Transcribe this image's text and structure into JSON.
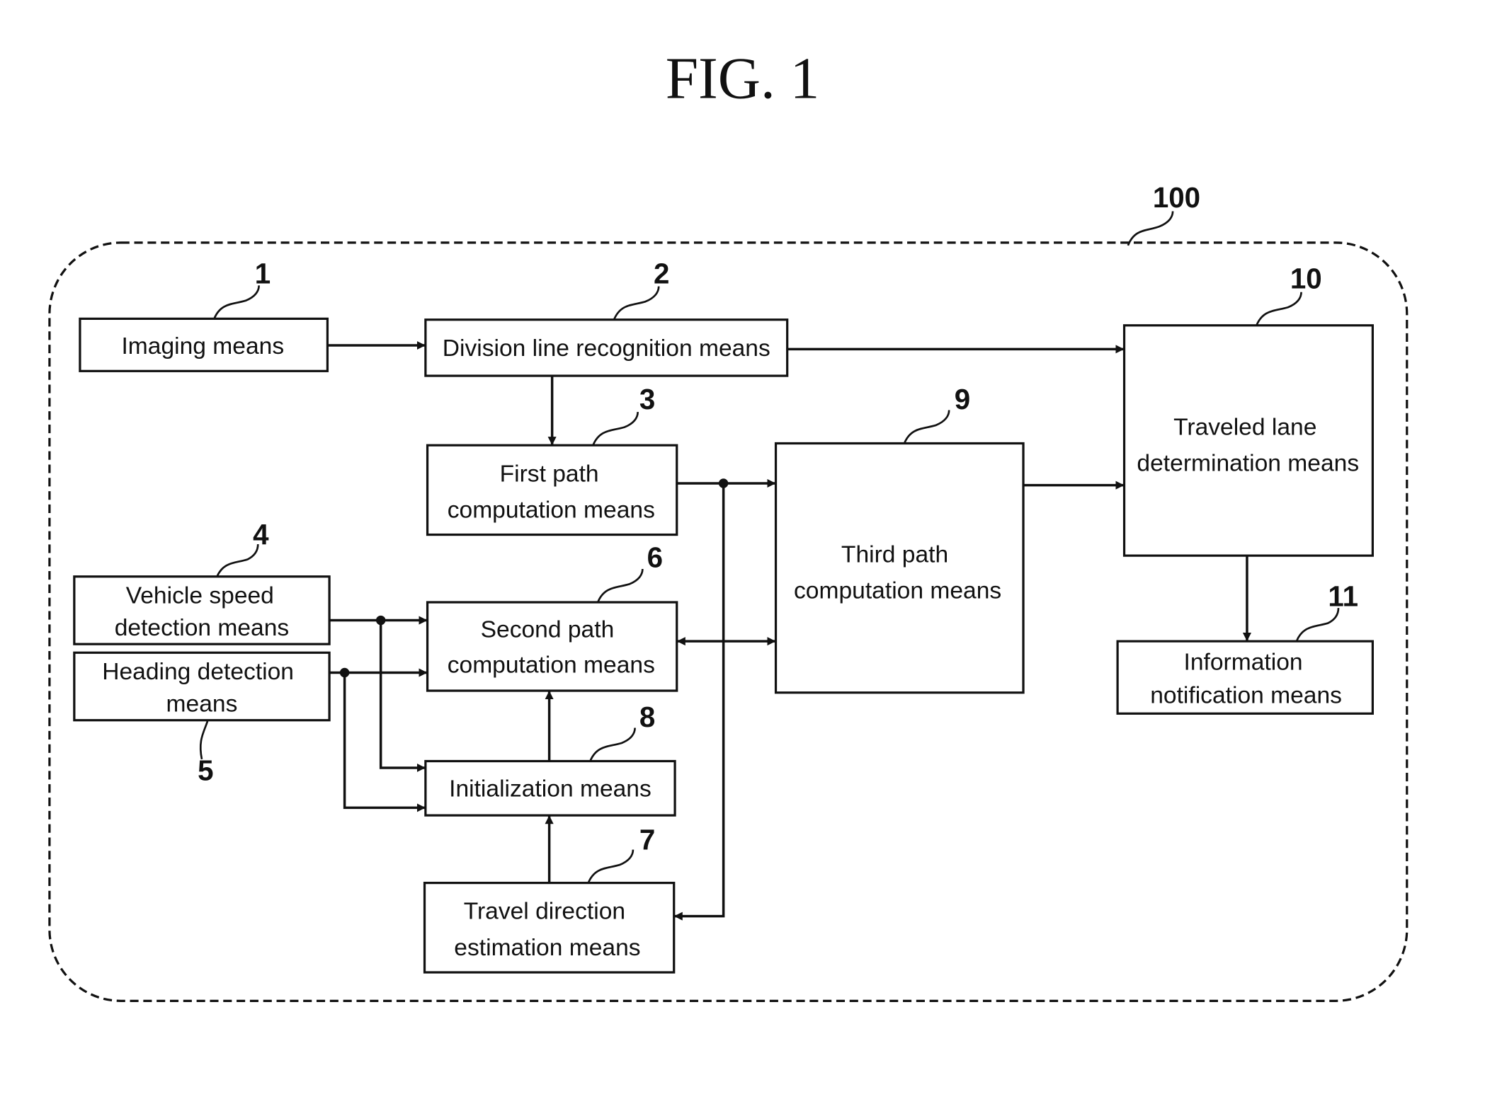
{
  "figure": {
    "title": "FIG. 1",
    "system_ref": "100"
  },
  "blocks": [
    {
      "id": "imaging",
      "ref": "1",
      "lines": [
        "Imaging means"
      ]
    },
    {
      "id": "division",
      "ref": "2",
      "lines": [
        "Division line recognition means"
      ]
    },
    {
      "id": "first_path",
      "ref": "3",
      "lines": [
        "First path",
        "computation means"
      ]
    },
    {
      "id": "vehicle_speed",
      "ref": "4",
      "lines": [
        "Vehicle speed",
        "detection means"
      ]
    },
    {
      "id": "heading",
      "ref": "5",
      "lines": [
        "Heading detection",
        "means"
      ]
    },
    {
      "id": "second_path",
      "ref": "6",
      "lines": [
        "Second path",
        "computation means"
      ]
    },
    {
      "id": "travel_dir",
      "ref": "7",
      "lines": [
        "Travel direction",
        "estimation means"
      ]
    },
    {
      "id": "init",
      "ref": "8",
      "lines": [
        "Initialization means"
      ]
    },
    {
      "id": "third_path",
      "ref": "9",
      "lines": [
        "Third path",
        "computation means"
      ]
    },
    {
      "id": "traveled_lane",
      "ref": "10",
      "lines": [
        "Traveled lane",
        "determination means"
      ]
    },
    {
      "id": "info_notify",
      "ref": "11",
      "lines": [
        "Information",
        "notification means"
      ]
    }
  ],
  "connections": [
    {
      "from": "imaging",
      "to": "division"
    },
    {
      "from": "division",
      "to": "traveled_lane"
    },
    {
      "from": "division",
      "to": "first_path"
    },
    {
      "from": "first_path",
      "to": "third_path"
    },
    {
      "from": "first_path",
      "to": "travel_dir"
    },
    {
      "from": "third_path",
      "to": "traveled_lane"
    },
    {
      "from": "traveled_lane",
      "to": "info_notify"
    },
    {
      "from": "vehicle_speed",
      "to": "second_path"
    },
    {
      "from": "vehicle_speed",
      "to": "init"
    },
    {
      "from": "heading",
      "to": "second_path"
    },
    {
      "from": "heading",
      "to": "init"
    },
    {
      "from": "second_path",
      "to": "third_path",
      "bidirectional": true
    },
    {
      "from": "init",
      "to": "second_path"
    },
    {
      "from": "travel_dir",
      "to": "init"
    }
  ]
}
